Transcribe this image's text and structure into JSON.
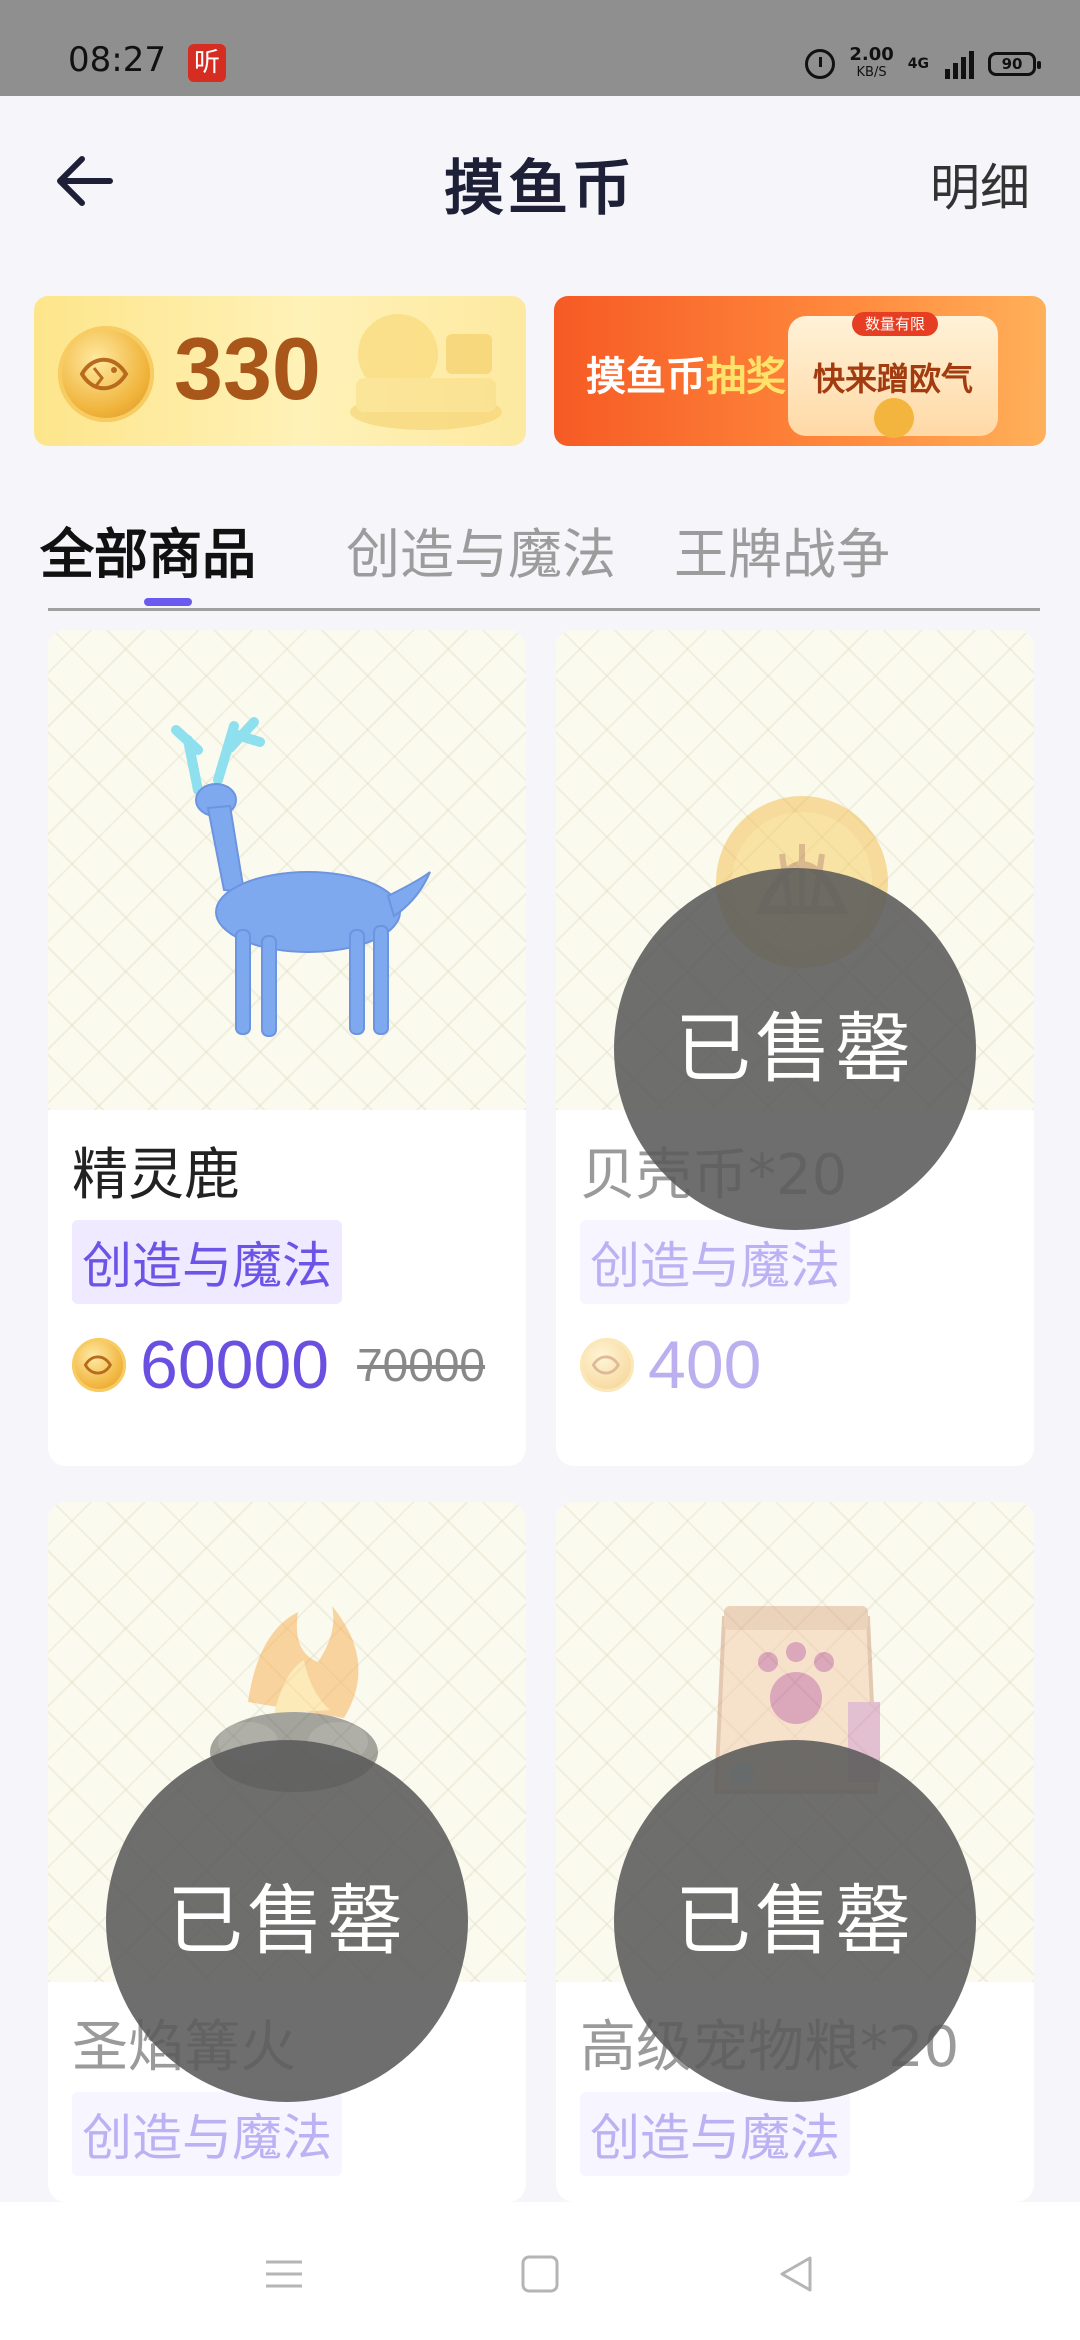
{
  "status_bar": {
    "time": "08:27",
    "app_badge": "听",
    "net_speed_value": "2.00",
    "net_speed_unit": "KB/S",
    "network": "4G",
    "battery": "90"
  },
  "header": {
    "title": "摸鱼币",
    "detail_link": "明细"
  },
  "balance": {
    "value": "330"
  },
  "lottery_banner": {
    "text_prefix": "摸鱼币",
    "text_highlight": "抽奖",
    "box_label": "快来蹭欧气",
    "box_tag": "数量有限"
  },
  "tabs": [
    {
      "label": "全部商品",
      "active": true
    },
    {
      "label": "创造与魔法",
      "active": false
    },
    {
      "label": "王牌战争",
      "active": false
    }
  ],
  "products": [
    {
      "name": "精灵鹿",
      "category": "创造与魔法",
      "price": "60000",
      "original_price": "70000",
      "sold_out": false,
      "icon": "deer-icon"
    },
    {
      "name": "贝壳币*20",
      "category": "创造与魔法",
      "price": "400",
      "original_price": "",
      "sold_out": true,
      "sold_out_label": "已售罄",
      "icon": "shell-coin-icon"
    },
    {
      "name": "圣焰篝火",
      "category": "创造与魔法",
      "price": "",
      "original_price": "",
      "sold_out": true,
      "sold_out_label": "已售罄",
      "icon": "campfire-icon"
    },
    {
      "name": "高级宠物粮*20",
      "category": "创造与魔法",
      "price": "",
      "original_price": "",
      "sold_out": true,
      "sold_out_label": "已售罄",
      "icon": "pet-food-bag-icon"
    }
  ],
  "colors": {
    "accent": "#6a5af0",
    "price": "#6a4fe0",
    "balance_text": "#a9561b",
    "lottery_orange": "#f65a24"
  },
  "navigation": {
    "buttons": [
      "menu-icon",
      "home-square-icon",
      "back-triangle-icon"
    ]
  }
}
